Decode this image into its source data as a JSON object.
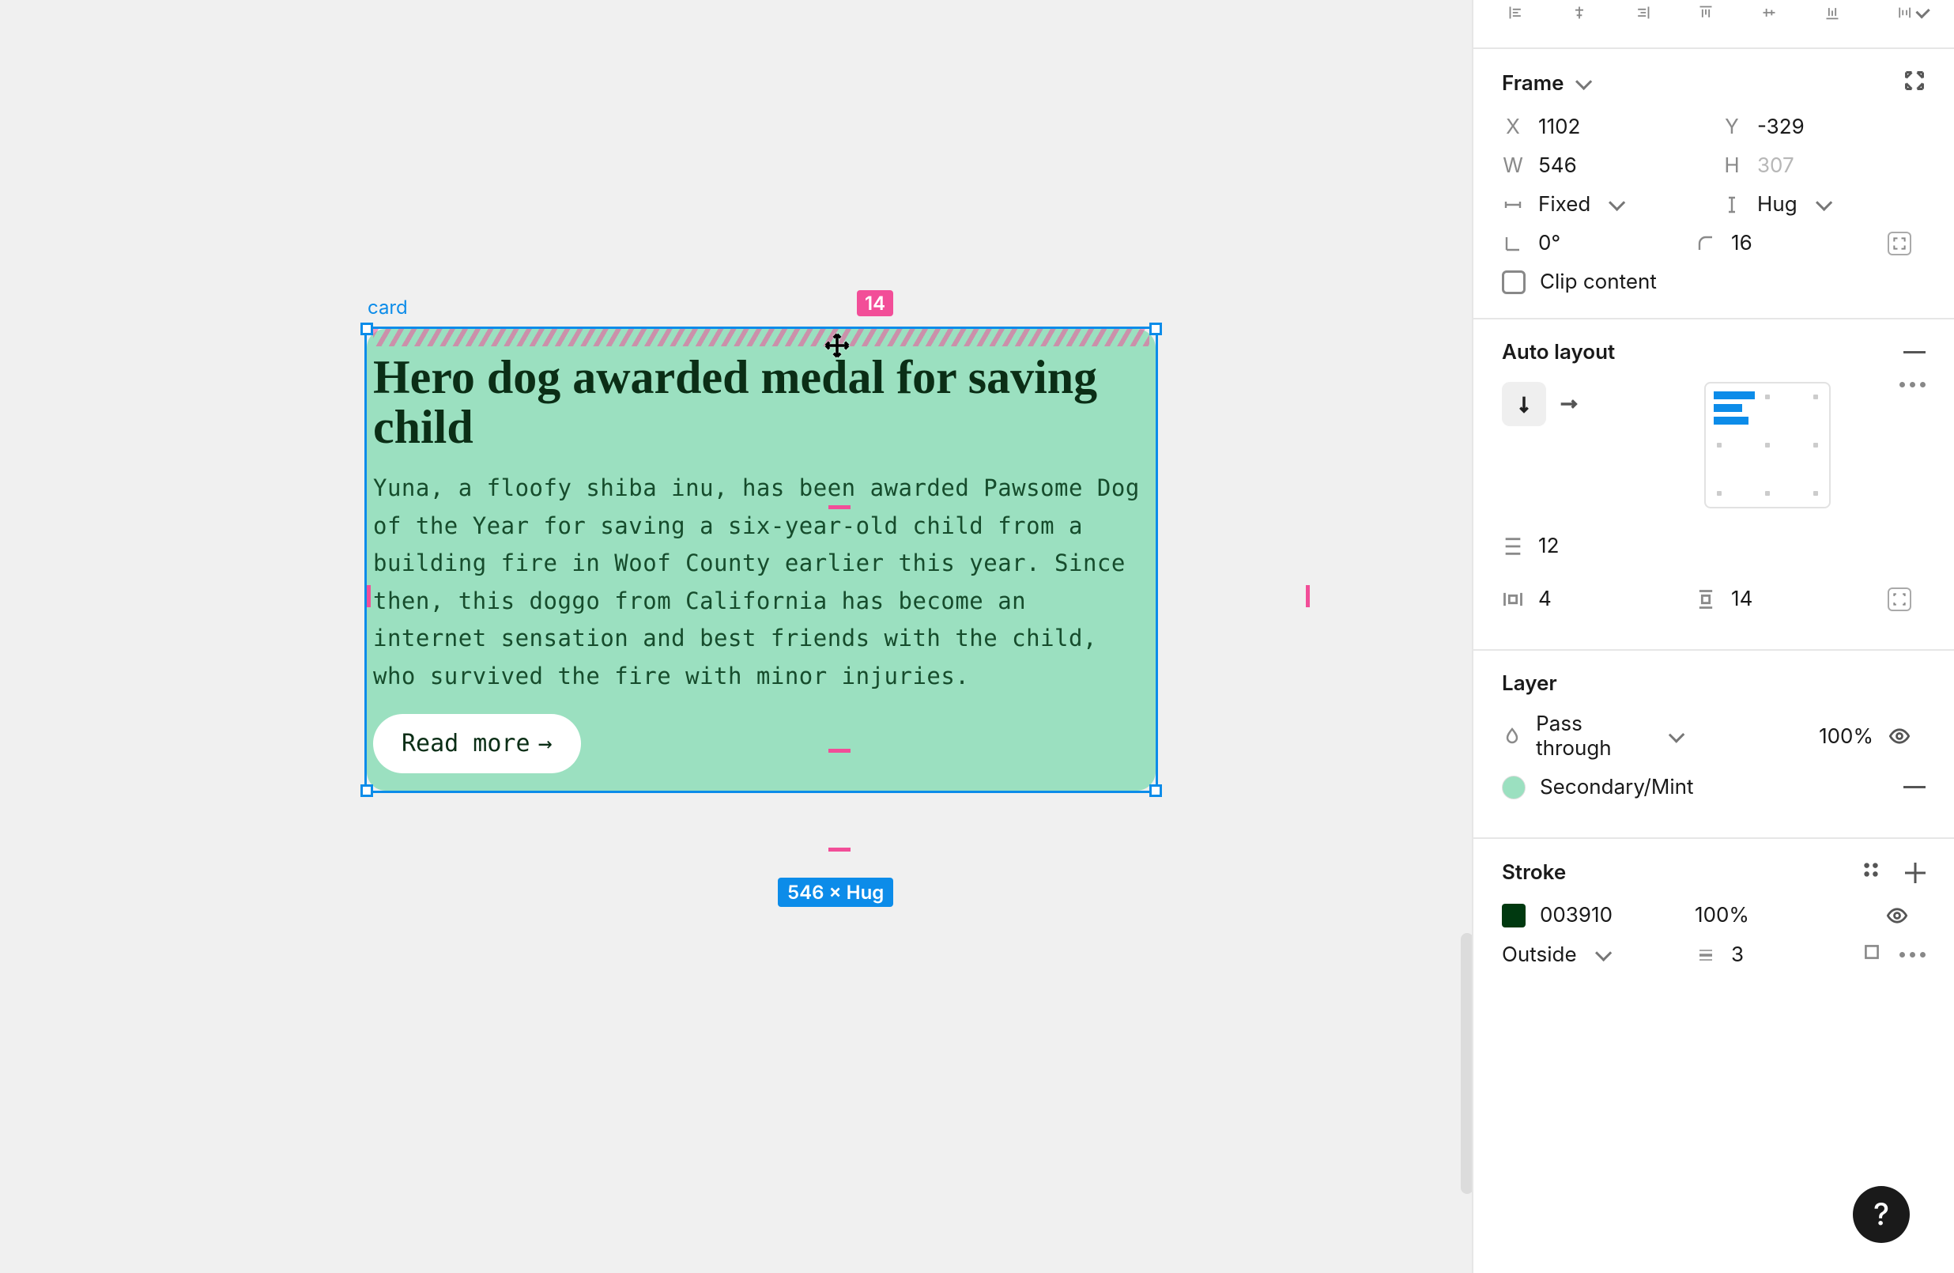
{
  "canvas": {
    "frame_label": "card",
    "padding_badge": "14",
    "dim_badge": "546 × Hug",
    "card": {
      "title": "Hero dog awarded medal for saving child",
      "body": "Yuna, a floofy shiba inu, has been awarded Pawsome Dog of the Year for saving a six-year-old child from a building fire in Woof County earlier this year. Since then, this doggo from California has become an internet sensation and best friends with the child, who survived the fire with minor injuries.",
      "button_label": "Read more",
      "button_glyph": "→"
    }
  },
  "panel": {
    "frame": {
      "title": "Frame",
      "x_label": "X",
      "x": "1102",
      "y_label": "Y",
      "y": "-329",
      "w_label": "W",
      "w": "546",
      "h_label": "H",
      "h": "307",
      "w_mode": "Fixed",
      "h_mode": "Hug",
      "rotation": "0°",
      "corner": "16",
      "clip_label": "Clip content"
    },
    "autolayout": {
      "title": "Auto layout",
      "gap": "12",
      "pad_h": "4",
      "pad_v": "14"
    },
    "layer": {
      "title": "Layer",
      "blend": "Pass through",
      "opacity": "100%",
      "color_name": "Secondary/Mint",
      "color_hex": "#9be0c0"
    },
    "stroke": {
      "title": "Stroke",
      "hex": "003910",
      "opacity": "100%",
      "position": "Outside",
      "weight": "3"
    },
    "help": "?"
  }
}
